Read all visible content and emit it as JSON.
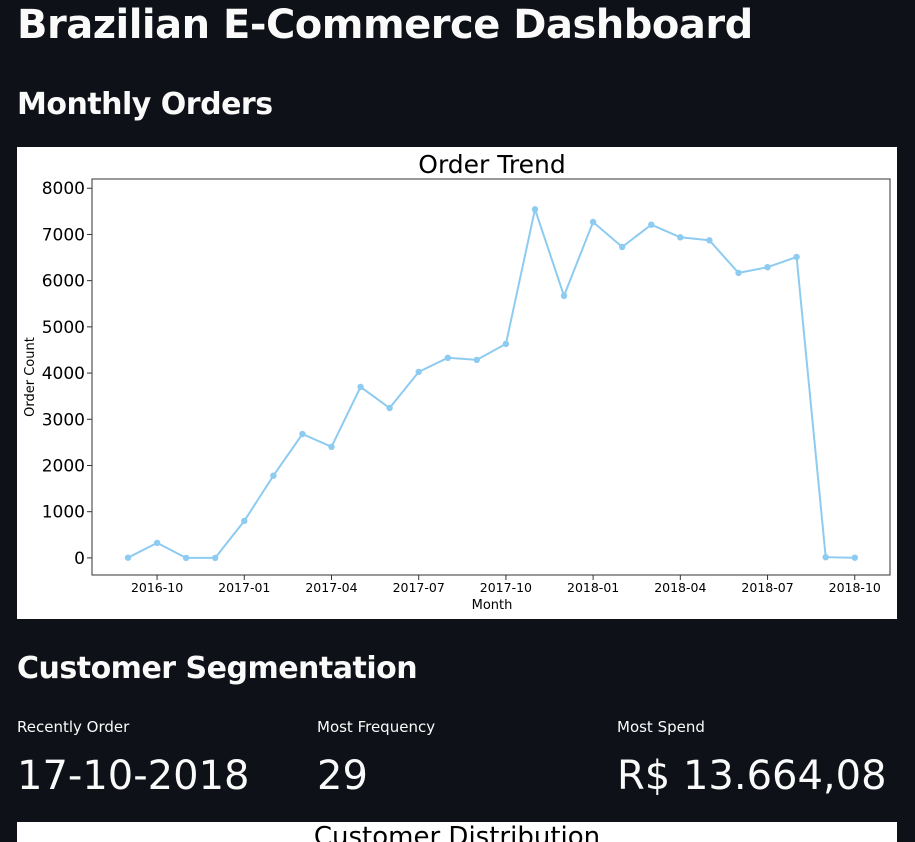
{
  "page": {
    "title": "Brazilian E-Commerce Dashboard"
  },
  "sections": {
    "monthly_orders": "Monthly Orders",
    "customer_segmentation": "Customer Segmentation"
  },
  "metrics": [
    {
      "label": "Recently Order",
      "value": "17-10-2018"
    },
    {
      "label": "Most Frequency",
      "value": "29"
    },
    {
      "label": "Most Spend",
      "value": "R$ 13.664,08"
    }
  ],
  "colors": {
    "background": "#0e1117",
    "line": "#8ecbf1"
  },
  "chart_data": [
    {
      "type": "line",
      "title": "Order Trend",
      "xlabel": "Month",
      "ylabel": "Order Count",
      "x": [
        "2016-09",
        "2016-10",
        "2016-11",
        "2016-12",
        "2017-01",
        "2017-02",
        "2017-03",
        "2017-04",
        "2017-05",
        "2017-06",
        "2017-07",
        "2017-08",
        "2017-09",
        "2017-10",
        "2017-11",
        "2017-12",
        "2018-01",
        "2018-02",
        "2018-03",
        "2018-04",
        "2018-05",
        "2018-06",
        "2018-07",
        "2018-08",
        "2018-09",
        "2018-10"
      ],
      "y": [
        4,
        324,
        0,
        1,
        800,
        1780,
        2682,
        2404,
        3700,
        3245,
        4026,
        4331,
        4285,
        4631,
        7544,
        5673,
        7269,
        6728,
        7211,
        6939,
        6873,
        6167,
        6292,
        6512,
        16,
        4
      ],
      "x_ticks": [
        "2016-10",
        "2017-01",
        "2017-04",
        "2017-07",
        "2017-10",
        "2018-01",
        "2018-04",
        "2018-07",
        "2018-10"
      ],
      "y_ticks": [
        0,
        1000,
        2000,
        3000,
        4000,
        5000,
        6000,
        7000,
        8000
      ],
      "ylim": [
        -370,
        8200
      ],
      "grid": false,
      "legend": "none"
    },
    {
      "type": "bar",
      "title": "Customer Distribution"
    }
  ]
}
